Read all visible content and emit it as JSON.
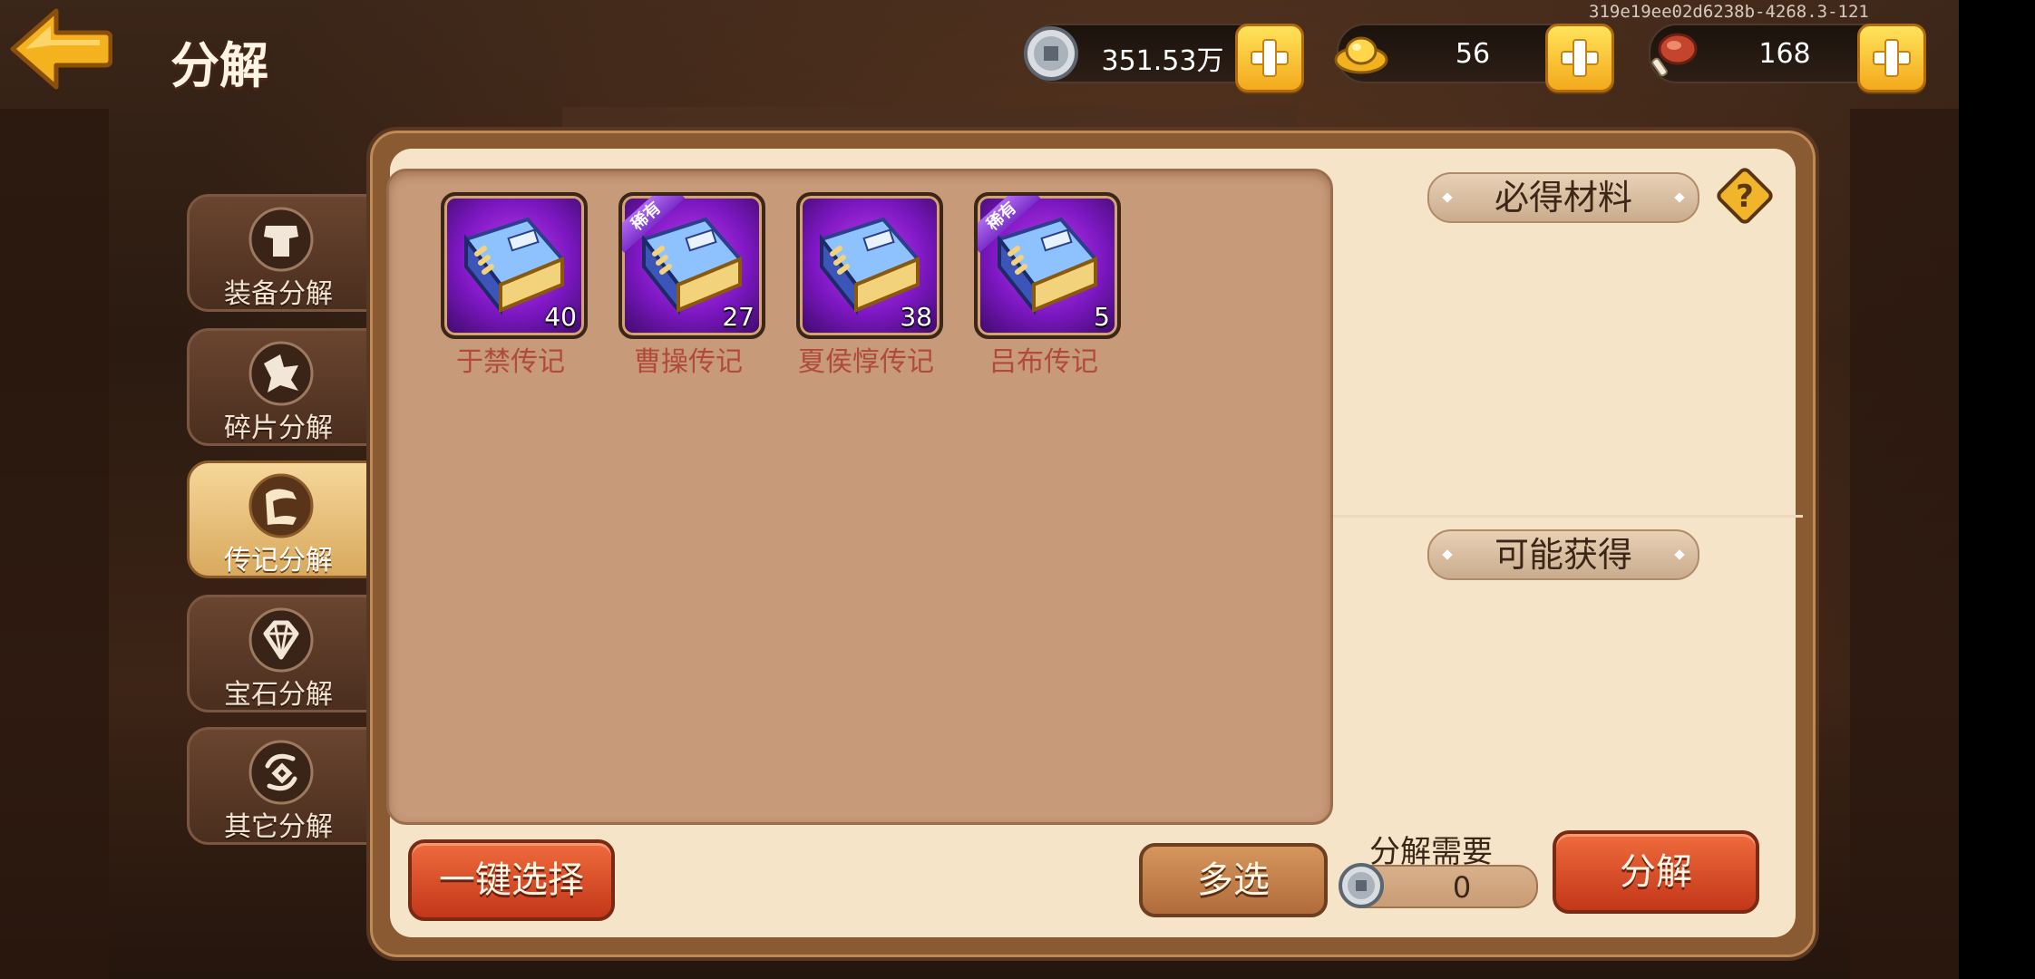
{
  "build_id": "319e19ee02d6238b-4268.3-121",
  "header": {
    "title": "分解",
    "back_icon": "arrow-left-icon"
  },
  "resources": [
    {
      "name": "silver-coin",
      "icon": "coin-icon",
      "value": "351.53万"
    },
    {
      "name": "gold-ingot",
      "icon": "ingot-icon",
      "value": "56"
    },
    {
      "name": "stamina",
      "icon": "meat-drumstick-icon",
      "value": "168"
    }
  ],
  "tabs": [
    {
      "label": "装备分解",
      "icon": "armor-icon",
      "active": false
    },
    {
      "label": "碎片分解",
      "icon": "fragment-icon",
      "active": false
    },
    {
      "label": "传记分解",
      "icon": "scroll-icon",
      "active": true
    },
    {
      "label": "宝石分解",
      "icon": "gem-icon",
      "active": false
    },
    {
      "label": "其它分解",
      "icon": "swirl-icon",
      "active": false
    }
  ],
  "items": [
    {
      "name": "于禁传记",
      "count": "40",
      "rare": false
    },
    {
      "name": "曹操传记",
      "count": "27",
      "rare": true
    },
    {
      "name": "夏侯惇传记",
      "count": "38",
      "rare": false
    },
    {
      "name": "吕布传记",
      "count": "5",
      "rare": true
    }
  ],
  "rare_badge": "稀有",
  "right_panel": {
    "guaranteed_title": "必得材料",
    "possible_title": "可能获得",
    "help_icon": "question-mark-icon"
  },
  "bottom": {
    "auto_select": "一键选择",
    "multi_select": "多选",
    "cost_label": "分解需要",
    "cost_value": "0",
    "decompose": "分解"
  },
  "colors": {
    "accent_gold": "#f3a91c",
    "item_name": "#b24a3a",
    "rare_purple": "#7a2fc8",
    "button_red": "#c33719"
  }
}
